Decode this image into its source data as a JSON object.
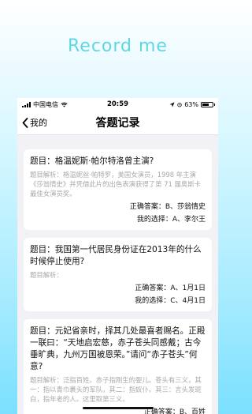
{
  "banner": {
    "title": "Record me"
  },
  "status_bar": {
    "carrier": "中国电信",
    "time": "20:59",
    "battery": "63%",
    "battery_level": 0.63
  },
  "nav": {
    "back_label": "我的",
    "title": "答题记录"
  },
  "records": [
    {
      "question": "题目：格温妮斯·帕尔特洛曾主演?",
      "explanation": "题目解析：格温妮丝·帕特罗，美国女演员，1998 年主演《莎翁情史》并凭借此片的出色表演获得了第 71 届奥斯卡最佳女演员奖。",
      "correct_answer": "正确答案：B、莎翁情史",
      "my_choice": "我的选择：A、李尔王"
    },
    {
      "question": "题目：我国第一代居民身份证在2013年的什么时候停止使用?",
      "explanation": "题目解析：",
      "correct_answer": "正确答案：A、1月1日",
      "my_choice": "我的选择：C、4月1日"
    },
    {
      "question": "题目：元妃省亲时，择其几处最喜者赐名。正殿一联曰：“天地启宏慈，赤子苍头同感戴；古今垂旷典，九州万国被恩荣。”请问“赤子苍头”何意?",
      "explanation": "题目解析：泛指百姓。赤子指刚生的婴儿。苍头有三义，其一：指以青巾裹头的军队。其二：指奴仆。其三：言头发斑白，指年老的人。这里取第三义。",
      "correct_answer": "正确答案：B、百姓",
      "my_choice": ""
    }
  ]
}
